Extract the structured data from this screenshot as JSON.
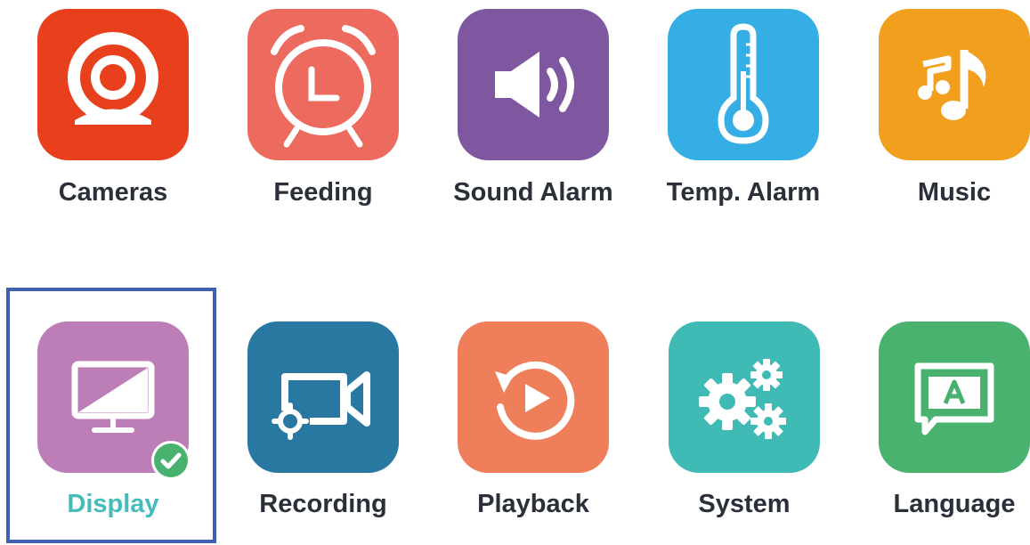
{
  "menu": {
    "items": [
      {
        "id": "cameras",
        "label": "Cameras",
        "icon": "camera-icon",
        "color": "#e8401c"
      },
      {
        "id": "feeding",
        "label": "Feeding",
        "icon": "alarm-clock-icon",
        "color": "#ec6a5e"
      },
      {
        "id": "sound-alarm",
        "label": "Sound Alarm",
        "icon": "speaker-icon",
        "color": "#7e57a0"
      },
      {
        "id": "temp-alarm",
        "label": "Temp. Alarm",
        "icon": "thermometer-icon",
        "color": "#35aee6"
      },
      {
        "id": "music",
        "label": "Music",
        "icon": "music-note-icon",
        "color": "#f29f1d"
      },
      {
        "id": "display",
        "label": "Display",
        "icon": "monitor-icon",
        "color": "#bd7eb7",
        "selected": true
      },
      {
        "id": "recording",
        "label": "Recording",
        "icon": "video-camera-gear-icon",
        "color": "#2878a1"
      },
      {
        "id": "playback",
        "label": "Playback",
        "icon": "replay-icon",
        "color": "#ef7e5b"
      },
      {
        "id": "system",
        "label": "System",
        "icon": "gears-icon",
        "color": "#3fbab5"
      },
      {
        "id": "language",
        "label": "Language",
        "icon": "language-a-icon",
        "color": "#49b26e"
      }
    ]
  },
  "colors": {
    "label_text": "#2a2f3a",
    "selected_label_text": "#44bcb9",
    "selection_frame": "#3f5fb0",
    "check_badge": "#49b26e"
  }
}
